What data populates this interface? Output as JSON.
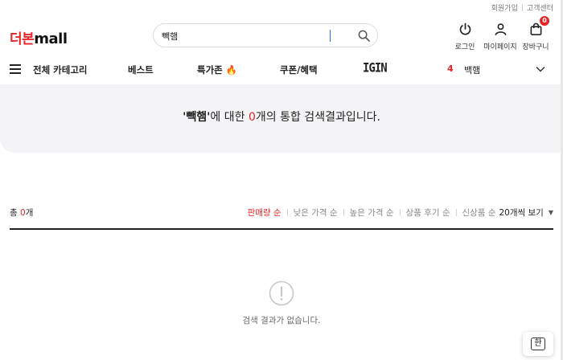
{
  "util_links": [
    "회원가입",
    "고객센터"
  ],
  "logo": {
    "ko": "더본",
    "en": "mall"
  },
  "search": {
    "value": "빽햄",
    "placeholder": ""
  },
  "header_icons": [
    {
      "name": "login",
      "label": "로그인"
    },
    {
      "name": "mypage",
      "label": "마이페이지"
    },
    {
      "name": "cart",
      "label": "장바구니",
      "badge": "0"
    }
  ],
  "nav": {
    "items": [
      "전체 카테고리",
      "베스트",
      "특가존 🔥",
      "쿠폰/혜택",
      "IGIN"
    ],
    "rank": "4",
    "trending_keyword": "백햄"
  },
  "result": {
    "quote_open": "'",
    "keyword": "빽햄",
    "quote_close": "'",
    "mid": "에 대한 ",
    "count": "0",
    "tail": "개의 통합 검색결과입니다."
  },
  "list": {
    "total_prefix": "총 ",
    "total_count": "0",
    "total_suffix": "개",
    "sorts": [
      "판매량 순",
      "낮은 가격 순",
      "높은 가격 순",
      "상품 후기 순",
      "신상품 순"
    ],
    "active_sort": "판매량 순",
    "per_page": "20개씩 보기"
  },
  "empty_message": "검색 결과가 없습니다.",
  "ime_label": "한",
  "colors": {
    "brand": "#e52528",
    "banner_bg": "#f4f4f6"
  }
}
